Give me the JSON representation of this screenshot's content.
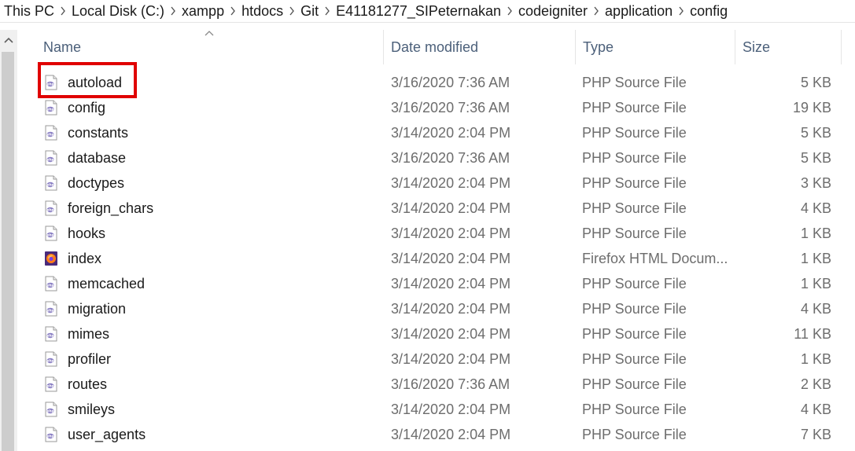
{
  "breadcrumb": [
    "This PC",
    "Local Disk (C:)",
    "xampp",
    "htdocs",
    "Git",
    "E41181277_SIPeternakan",
    "codeigniter",
    "application",
    "config"
  ],
  "columns": {
    "name": "Name",
    "date": "Date modified",
    "type": "Type",
    "size": "Size"
  },
  "files": [
    {
      "name": "autoload",
      "date": "3/16/2020 7:36 AM",
      "type": "PHP Source File",
      "size": "5 KB",
      "icon": "php-file-icon"
    },
    {
      "name": "config",
      "date": "3/16/2020 7:36 AM",
      "type": "PHP Source File",
      "size": "19 KB",
      "icon": "php-file-icon"
    },
    {
      "name": "constants",
      "date": "3/14/2020 2:04 PM",
      "type": "PHP Source File",
      "size": "5 KB",
      "icon": "php-file-icon"
    },
    {
      "name": "database",
      "date": "3/16/2020 7:36 AM",
      "type": "PHP Source File",
      "size": "5 KB",
      "icon": "php-file-icon"
    },
    {
      "name": "doctypes",
      "date": "3/14/2020 2:04 PM",
      "type": "PHP Source File",
      "size": "3 KB",
      "icon": "php-file-icon"
    },
    {
      "name": "foreign_chars",
      "date": "3/14/2020 2:04 PM",
      "type": "PHP Source File",
      "size": "4 KB",
      "icon": "php-file-icon"
    },
    {
      "name": "hooks",
      "date": "3/14/2020 2:04 PM",
      "type": "PHP Source File",
      "size": "1 KB",
      "icon": "php-file-icon"
    },
    {
      "name": "index",
      "date": "3/14/2020 2:04 PM",
      "type": "Firefox HTML Docum...",
      "size": "1 KB",
      "icon": "firefox-html-icon"
    },
    {
      "name": "memcached",
      "date": "3/14/2020 2:04 PM",
      "type": "PHP Source File",
      "size": "1 KB",
      "icon": "php-file-icon"
    },
    {
      "name": "migration",
      "date": "3/14/2020 2:04 PM",
      "type": "PHP Source File",
      "size": "4 KB",
      "icon": "php-file-icon"
    },
    {
      "name": "mimes",
      "date": "3/14/2020 2:04 PM",
      "type": "PHP Source File",
      "size": "11 KB",
      "icon": "php-file-icon"
    },
    {
      "name": "profiler",
      "date": "3/14/2020 2:04 PM",
      "type": "PHP Source File",
      "size": "1 KB",
      "icon": "php-file-icon"
    },
    {
      "name": "routes",
      "date": "3/16/2020 7:36 AM",
      "type": "PHP Source File",
      "size": "2 KB",
      "icon": "php-file-icon"
    },
    {
      "name": "smileys",
      "date": "3/14/2020 2:04 PM",
      "type": "PHP Source File",
      "size": "4 KB",
      "icon": "php-file-icon"
    },
    {
      "name": "user_agents",
      "date": "3/14/2020 2:04 PM",
      "type": "PHP Source File",
      "size": "7 KB",
      "icon": "php-file-icon"
    }
  ],
  "colors": {
    "highlight_border": "#e00000",
    "header_text": "#4c607a",
    "detail_text": "#6d6d6d",
    "php_purple": "#8a7fc4"
  }
}
